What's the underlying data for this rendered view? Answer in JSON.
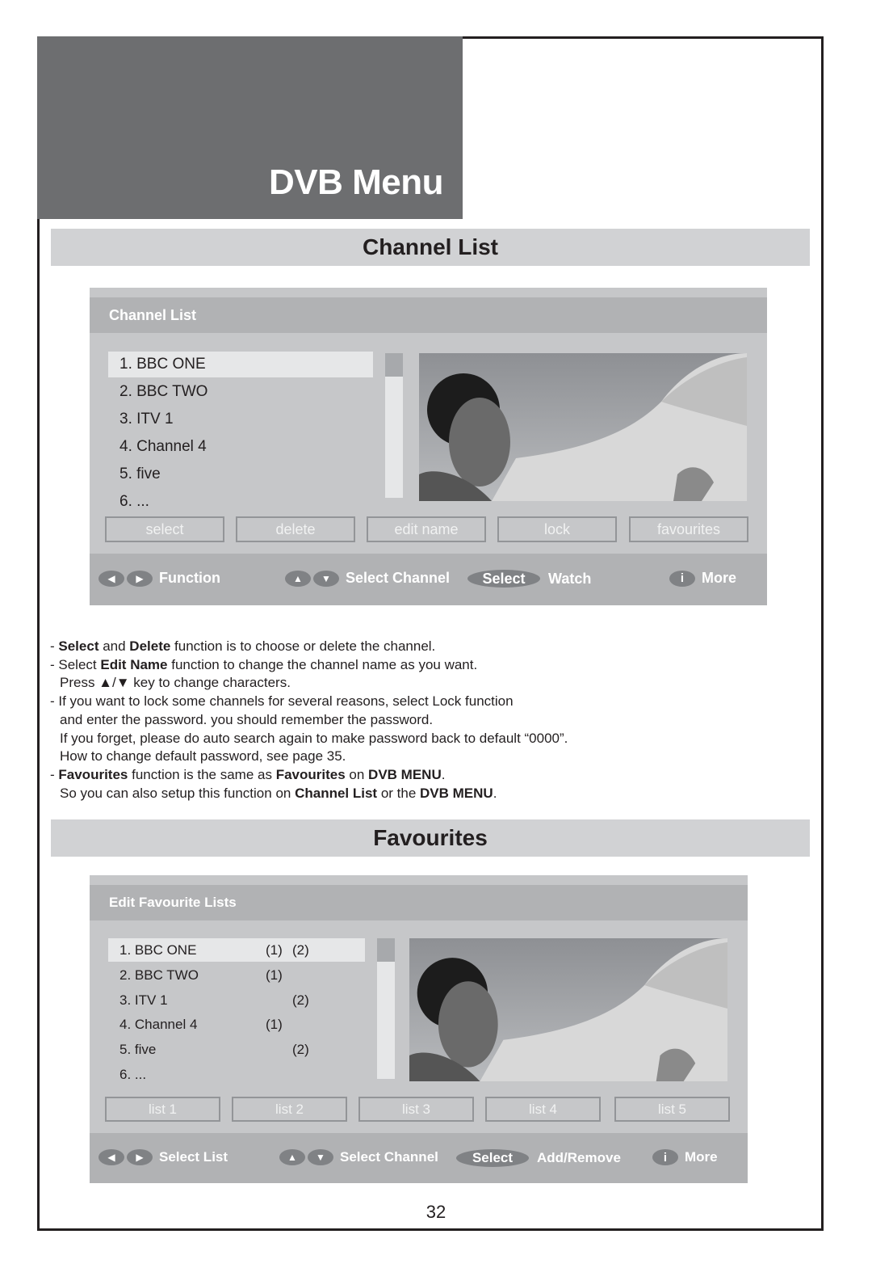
{
  "header": {
    "title": "DVB Menu"
  },
  "sections": {
    "channel_list": "Channel List",
    "favourites": "Favourites"
  },
  "channel_list_osd": {
    "title": "Channel List",
    "channels": [
      {
        "label": "1. BBC ONE",
        "selected": true
      },
      {
        "label": "2. BBC TWO",
        "selected": false
      },
      {
        "label": "3. ITV 1",
        "selected": false
      },
      {
        "label": "4. Channel 4",
        "selected": false
      },
      {
        "label": "5. five",
        "selected": false
      },
      {
        "label": "6. ...",
        "selected": false
      }
    ],
    "buttons": [
      "select",
      "delete",
      "edit name",
      "lock",
      "favourites"
    ],
    "hints": {
      "left_right_icon": "◀ ▶",
      "function_label": "Function",
      "up_down_icon": "▲ ▼",
      "select_channel_label": "Select Channel",
      "select_key": "Select",
      "watch_label": "Watch",
      "info_key": "i",
      "more_label": "More"
    },
    "preview_image": "woman-with-horse-photo"
  },
  "notes": {
    "line1": {
      "b1": "Select",
      "t1": " and ",
      "b2": "Delete",
      "t2": " function is to choose or delete the channel."
    },
    "line2": {
      "t0": "- Select ",
      "b1": "Edit Name",
      "t1": " function to change the channel name as you want."
    },
    "line3": "Press ▲/▼ key to change characters.",
    "line4": "- If you want to lock some channels for several reasons, select Lock function",
    "line5": "and enter the password. you should remember the password.",
    "line6": "If you forget, please do auto search again to make password back to default “0000”.",
    "line7": "How to change default password, see page 35.",
    "line8": {
      "b1": "Favourites",
      "t1": " function is the same as ",
      "b2": "Favourites",
      "t2": " on ",
      "b3": "DVB MENU",
      "t3": "."
    },
    "line9": {
      "t0": "So you can also setup this function on ",
      "b1": "Channel List",
      "t1": " or the ",
      "b2": "DVB MENU",
      "t2": "."
    }
  },
  "favourites_osd": {
    "title": "Edit Favourite Lists",
    "channels": [
      {
        "label": "1. BBC ONE",
        "list1": "(1)",
        "list2": "(2)",
        "selected": true
      },
      {
        "label": "2. BBC TWO",
        "list1": "(1)",
        "list2": "",
        "selected": false
      },
      {
        "label": "3. ITV 1",
        "list1": "",
        "list2": "(2)",
        "selected": false
      },
      {
        "label": "4. Channel 4",
        "list1": "(1)",
        "list2": "",
        "selected": false
      },
      {
        "label": "5. five",
        "list1": "",
        "list2": "(2)",
        "selected": false
      },
      {
        "label": "6. ...",
        "list1": "",
        "list2": "",
        "selected": false
      }
    ],
    "buttons": [
      "list 1",
      "list 2",
      "list 3",
      "list 4",
      "list 5"
    ],
    "hints": {
      "left_right_icon": "◀ ▶",
      "select_list_label": "Select List",
      "up_down_icon": "▲ ▼",
      "select_channel_label": "Select Channel",
      "select_key": "Select",
      "add_remove_label": "Add/Remove",
      "info_key": "i",
      "more_label": "More"
    },
    "preview_image": "woman-with-horse-photo"
  },
  "page_number": "32"
}
